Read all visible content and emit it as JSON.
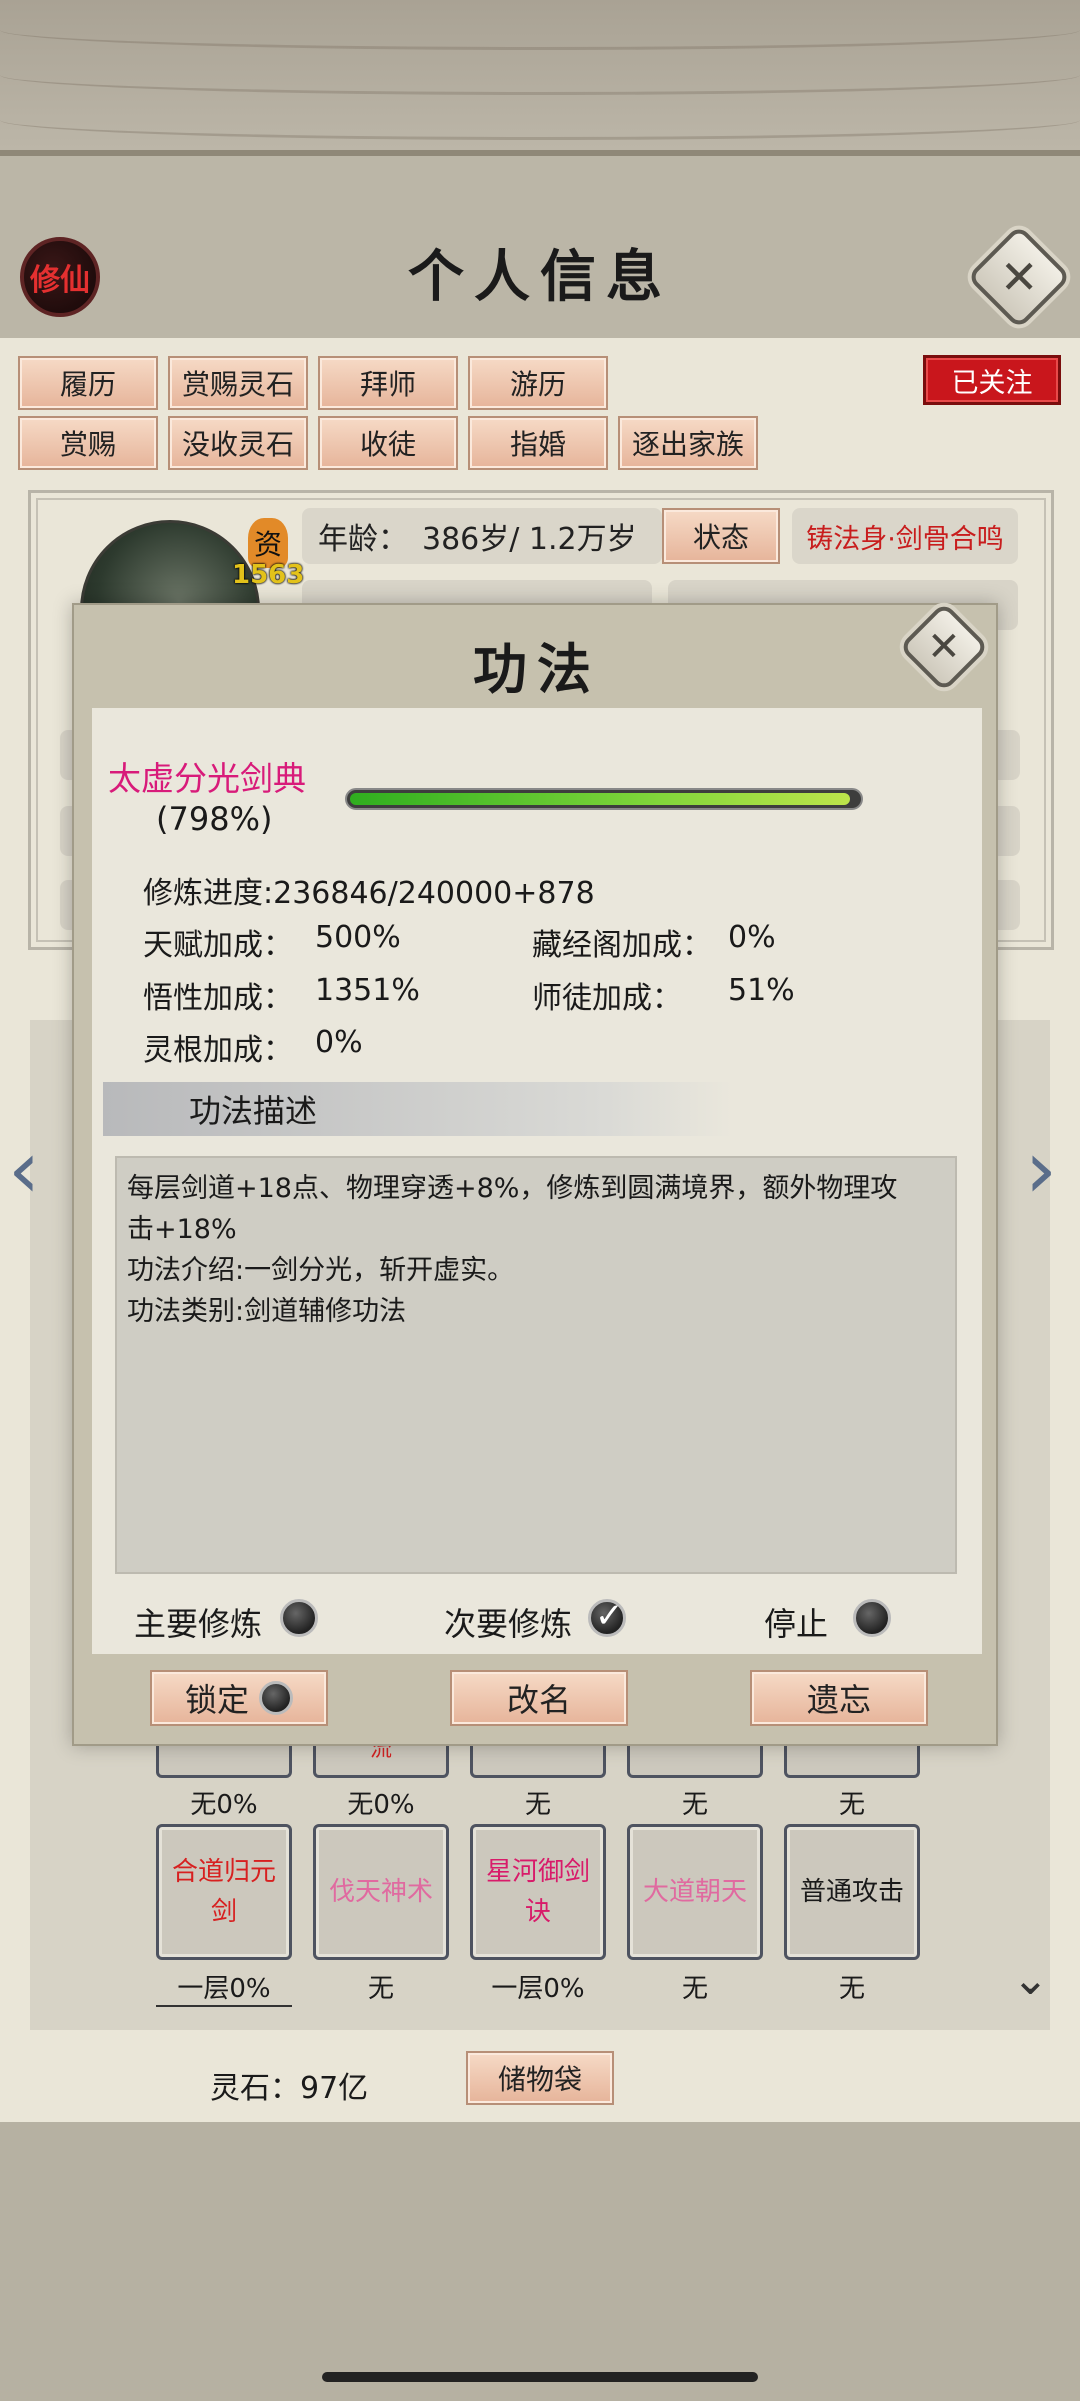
{
  "header": {
    "seal": "修仙",
    "title": "个人信息",
    "close": "✕"
  },
  "actions_row1": [
    "履历",
    "赏赐灵石",
    "拜师",
    "游历"
  ],
  "actions_row2": [
    "赏赐",
    "没收灵石",
    "收徒",
    "指婚",
    "逐出家族"
  ],
  "follow_label": "已关注",
  "profile": {
    "zi_badge": "资",
    "zi_value": "1563",
    "age_label": "年龄：",
    "age_value": "386岁/ 1.2万岁",
    "state_button": "状态",
    "body_tag": "铸法身·剑骨合鸣"
  },
  "modal": {
    "title": "功法",
    "close": "✕",
    "skill_name": "太虚分光剑典",
    "skill_percent": "(798%)",
    "progress_fraction": 0.985,
    "cultivation_label": "修炼进度:",
    "cultivation_value": "236846/240000+878",
    "talent_label": "天赋加成：",
    "talent_value": "500%",
    "library_label": "藏经阁加成：",
    "library_value": "0%",
    "insight_label": "悟性加成：",
    "insight_value": "1351%",
    "mentor_label": "师徒加成：",
    "mentor_value": "51%",
    "root_label": "灵根加成：",
    "root_value": "0%",
    "desc_header": "功法描述",
    "desc_line1": "每层剑道+18点、物理穿透+8%，修炼到圆满境界，额外物理攻",
    "desc_line2": "击+18%",
    "desc_line3": "功法介绍:一剑分光，斩开虚实。",
    "desc_line4": "功法类别:剑道辅修功法",
    "mode_primary": "主要修炼",
    "mode_secondary": "次要修炼",
    "mode_stop": "停止",
    "btn_lock": "锁定",
    "btn_rename": "改名",
    "btn_forget": "遗忘"
  },
  "skill_grid": {
    "partial_cell_text": "流",
    "row1_labels": [
      "无0%",
      "无0%",
      "无",
      "无",
      "无"
    ],
    "row2_names": [
      "合道归元剑",
      "伐天神术",
      "星河御剑诀",
      "大道朝天",
      "普通攻击"
    ],
    "row2_labels": [
      "一层0%",
      "无",
      "一层0%",
      "无",
      "无"
    ]
  },
  "footer": {
    "stones": "灵石：97亿",
    "bag": "储物袋"
  },
  "colors": {
    "accent_red": "#c9161c",
    "name_pink": "#d81b7a",
    "progress_green": "#4cc22a"
  }
}
